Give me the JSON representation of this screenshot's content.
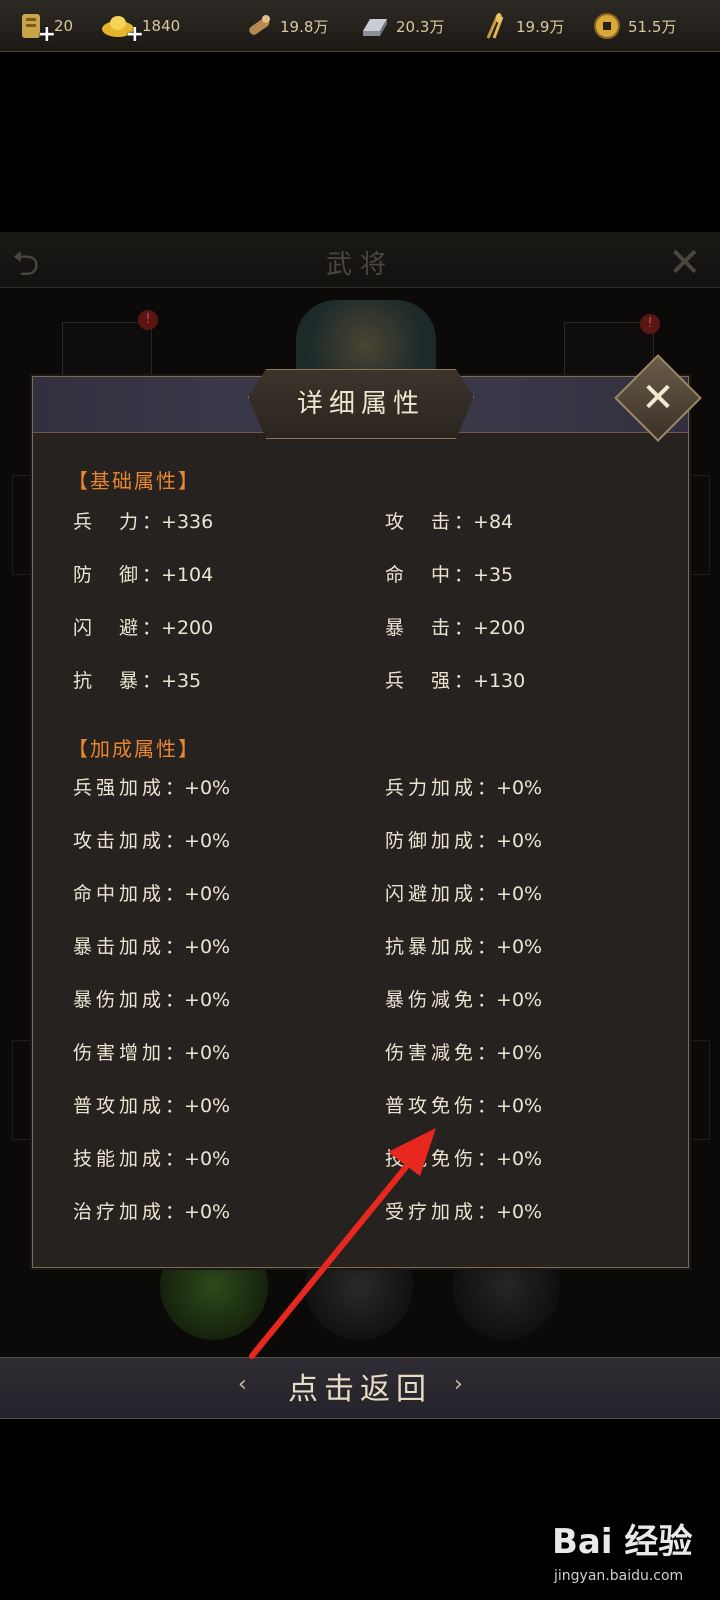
{
  "resources": [
    {
      "icon": "scroll-icon",
      "value": "20"
    },
    {
      "icon": "gold-ingot-icon",
      "value": "1840"
    },
    {
      "icon": "wood-icon",
      "value": "19.8万"
    },
    {
      "icon": "iron-icon",
      "value": "20.3万"
    },
    {
      "icon": "grain-icon",
      "value": "19.9万"
    },
    {
      "icon": "coin-icon",
      "value": "51.5万"
    }
  ],
  "background": {
    "title": "武将",
    "alert_mark": "!"
  },
  "dialog": {
    "title": "详细属性",
    "basic_section": "【基础属性】",
    "basic_stats": [
      {
        "label": "兵　力",
        "value": "+336"
      },
      {
        "label": "攻　击",
        "value": "+84"
      },
      {
        "label": "防　御",
        "value": "+104"
      },
      {
        "label": "命　中",
        "value": "+35"
      },
      {
        "label": "闪　避",
        "value": "+200"
      },
      {
        "label": "暴　击",
        "value": "+200"
      },
      {
        "label": "抗　暴",
        "value": "+35"
      },
      {
        "label": "兵　强",
        "value": "+130"
      }
    ],
    "bonus_section": "【加成属性】",
    "bonus_stats": [
      {
        "label": "兵强加成",
        "value": "+0%"
      },
      {
        "label": "兵力加成",
        "value": "+0%"
      },
      {
        "label": "攻击加成",
        "value": "+0%"
      },
      {
        "label": "防御加成",
        "value": "+0%"
      },
      {
        "label": "命中加成",
        "value": "+0%"
      },
      {
        "label": "闪避加成",
        "value": "+0%"
      },
      {
        "label": "暴击加成",
        "value": "+0%"
      },
      {
        "label": "抗暴加成",
        "value": "+0%"
      },
      {
        "label": "暴伤加成",
        "value": "+0%"
      },
      {
        "label": "暴伤减免",
        "value": "+0%"
      },
      {
        "label": "伤害增加",
        "value": "+0%"
      },
      {
        "label": "伤害减免",
        "value": "+0%"
      },
      {
        "label": "普攻加成",
        "value": "+0%"
      },
      {
        "label": "普攻免伤",
        "value": "+0%"
      },
      {
        "label": "技能加成",
        "value": "+0%"
      },
      {
        "label": "技能免伤",
        "value": "+0%"
      },
      {
        "label": "治疗加成",
        "value": "+0%"
      },
      {
        "label": "受疗加成",
        "value": "+0%"
      }
    ]
  },
  "return_button": "点击返回",
  "watermark": {
    "logo": "Bai 经验",
    "url": "jingyan.baidu.com"
  },
  "colors": {
    "section_orange": "#e88530",
    "annotation_red": "#e8281e"
  }
}
